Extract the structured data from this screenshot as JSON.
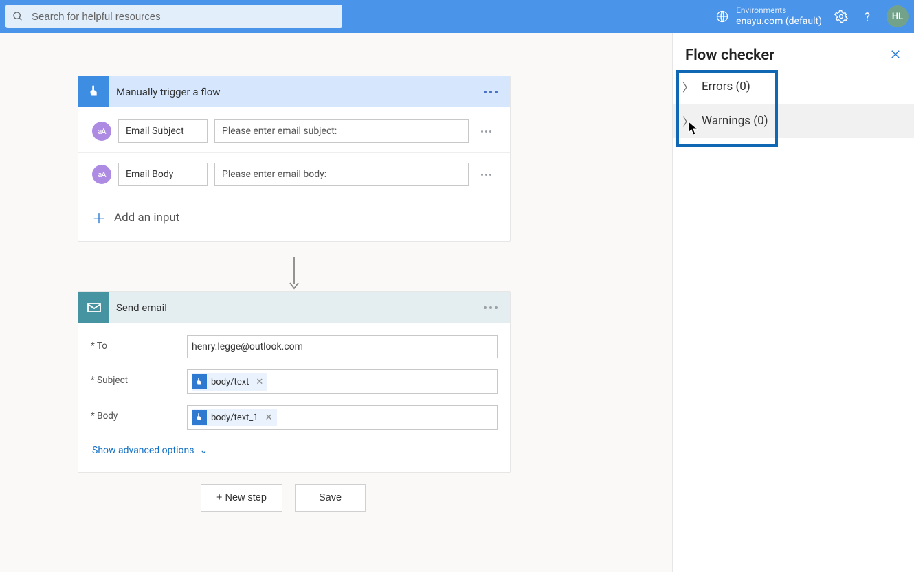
{
  "topbar": {
    "search_placeholder": "Search for helpful resources",
    "env_label": "Environments",
    "env_name": "enayu.com (default)",
    "avatar_initials": "HL"
  },
  "trigger_card": {
    "title": "Manually trigger a flow",
    "rows": [
      {
        "badge": "aA",
        "name": "Email Subject",
        "placeholder": "Please enter email subject:"
      },
      {
        "badge": "aA",
        "name": "Email Body",
        "placeholder": "Please enter email body:"
      }
    ],
    "add_input_label": "Add an input"
  },
  "action_card": {
    "title": "Send email",
    "fields": {
      "to": {
        "label": "* To",
        "value": "henry.legge@outlook.com"
      },
      "subject": {
        "label": "* Subject",
        "token": "body/text"
      },
      "body": {
        "label": "* Body",
        "token": "body/text_1"
      }
    },
    "advanced_label": "Show advanced options"
  },
  "buttons": {
    "new_step": "+ New step",
    "save": "Save"
  },
  "panel": {
    "title": "Flow checker",
    "errors_label": "Errors (0)",
    "warnings_label": "Warnings (0)"
  }
}
